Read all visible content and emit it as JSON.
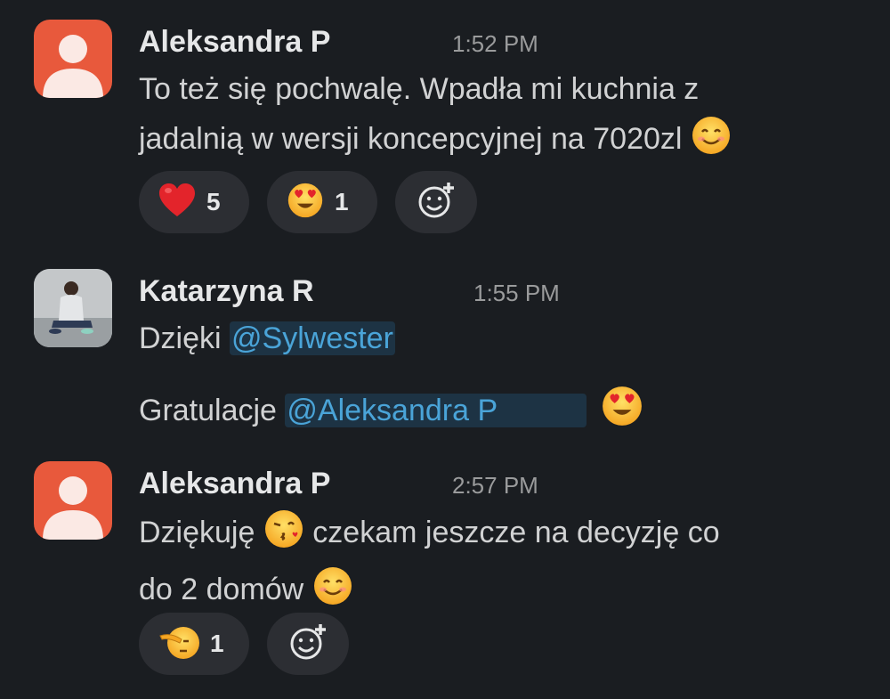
{
  "messages": [
    {
      "author": "Aleksandra P",
      "time": "1:52 PM",
      "lines": [
        "To też się pochwalę. Wpadła mi kuchnia z",
        "jadalnią w wersji koncepcyjnej na 7020zl"
      ],
      "line2_emoji": "smiling-face-icon",
      "reactions": [
        {
          "emoji": "red-heart-icon",
          "count": "5"
        },
        {
          "emoji": "heart-eyes-icon",
          "count": "1"
        }
      ]
    },
    {
      "author": "Katarzyna R",
      "time": "1:55 PM",
      "line1_prefix": "Dzięki ",
      "line1_mention": "@Sylwester",
      "line2_prefix": "Gratulacje ",
      "line2_mention": "@Aleksandra P",
      "line2_emoji": "heart-eyes-icon"
    },
    {
      "author": "Aleksandra P",
      "time": "2:57 PM",
      "line1_prefix": "Dziękuję",
      "line1_emoji": "kissing-face-icon",
      "line1_suffix": "czekam jeszcze na decyzję co",
      "line2": "do 2 domów",
      "line2_emoji": "smiling-face-icon",
      "reactions": [
        {
          "emoji": "saluting-face-icon",
          "count": "1"
        }
      ]
    }
  ],
  "colors": {
    "background": "#1a1d21",
    "mention_bg": "#1d3344",
    "mention_text": "#4aa4d8",
    "reaction_bg": "#2c2e33",
    "default_avatar": "#e8593c"
  }
}
